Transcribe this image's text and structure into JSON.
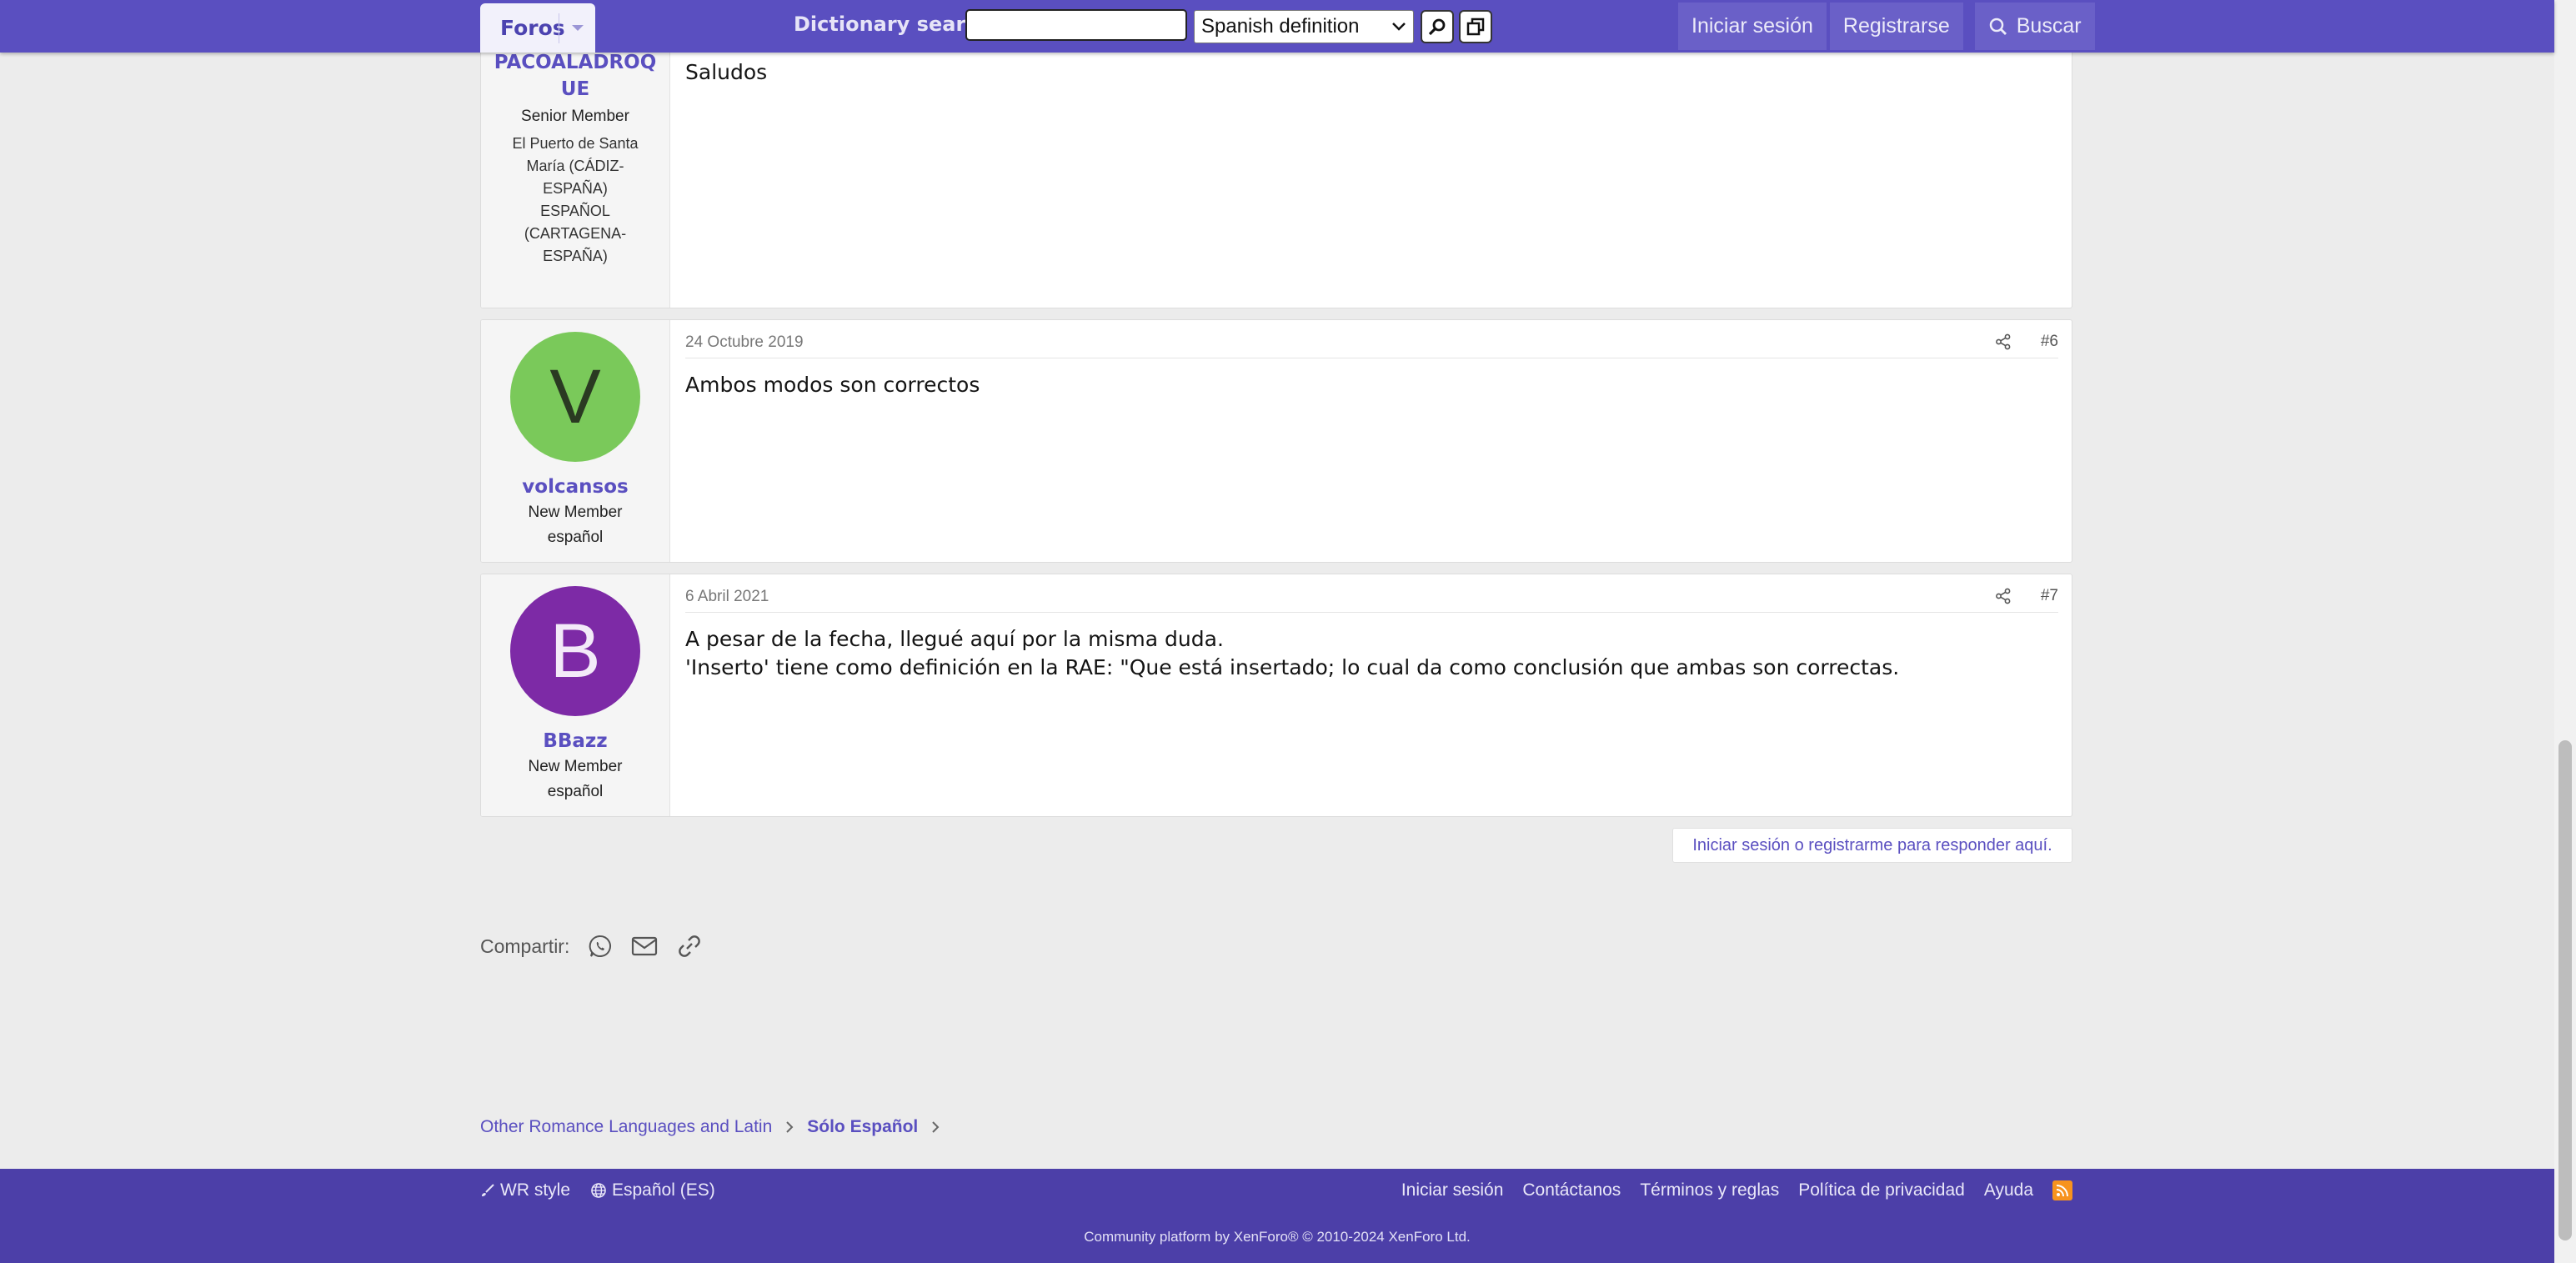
{
  "header": {
    "forums_tab": "Foros",
    "dictionary_label": "Dictionary search:",
    "dictionary_input_value": "",
    "dictionary_select_value": "Spanish definition",
    "login": "Iniciar sesión",
    "register": "Registrarse",
    "search": "Buscar"
  },
  "posts": [
    {
      "username": "PACOALADROQUE",
      "username_line1": "PACOALADROQ",
      "username_line2": "UE",
      "role": "Senior Member",
      "location_lines": [
        "El Puerto de Santa",
        "María (CÁDIZ-",
        "ESPAÑA)",
        "ESPAÑOL",
        "(CARTAGENA-",
        "ESPAÑA)"
      ],
      "body": [
        "Saludos"
      ]
    },
    {
      "date": "24 Octubre 2019",
      "number": "#6",
      "avatar_letter": "V",
      "avatar_color": "#7ac95a",
      "username": "volcansos",
      "role": "New Member",
      "language": "español",
      "body": [
        "Ambos modos son correctos"
      ]
    },
    {
      "date": "6 Abril 2021",
      "number": "#7",
      "avatar_letter": "B",
      "avatar_color": "#7d2aa6",
      "username": "BBazz",
      "role": "New Member",
      "language": "español",
      "body": [
        "A pesar de la fecha, llegué aquí por la misma duda.",
        "'Inserto' tiene como definición en la RAE: \"Que está insertado; lo cual da como conclusión que ambas son correctas."
      ]
    }
  ],
  "reply_prompt": "Iniciar sesión o registrarme para responder aquí.",
  "share": {
    "label": "Compartir:",
    "icons": [
      "whatsapp-icon",
      "email-icon",
      "link-icon"
    ]
  },
  "breadcrumb": [
    "Other Romance Languages and Latin",
    "Sólo Español"
  ],
  "footer": {
    "style": "WR style",
    "language": "Español (ES)",
    "links": [
      "Iniciar sesión",
      "Contáctanos",
      "Términos y reglas",
      "Política de privacidad",
      "Ayuda"
    ],
    "copyright": "Community platform by XenForo® © 2010-2024 XenForo Ltd."
  },
  "colors": {
    "header": "#5a4fc0",
    "footer": "#4c3fa8",
    "link": "#5a4fc0",
    "rss": "#f7931e"
  }
}
